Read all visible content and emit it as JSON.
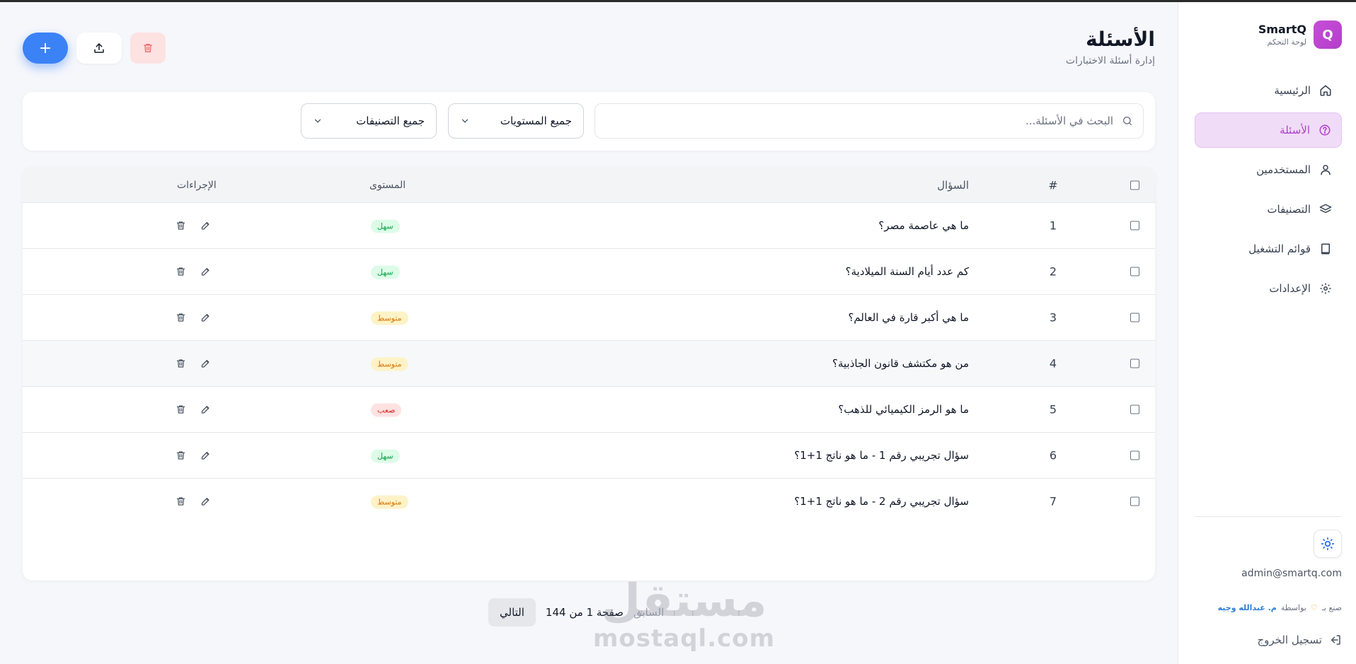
{
  "brand": {
    "logo_letter": "Q",
    "name": "SmartQ",
    "subtitle": "لوحة التحكم"
  },
  "sidebar": {
    "items": [
      {
        "label": "الرئيسية",
        "icon": "home-icon"
      },
      {
        "label": "الأسئلة",
        "icon": "help-circle-icon",
        "active": true
      },
      {
        "label": "المستخدمين",
        "icon": "user-icon"
      },
      {
        "label": "التصنيفات",
        "icon": "layers-icon"
      },
      {
        "label": "قوائم التشغيل",
        "icon": "book-icon"
      },
      {
        "label": "الإعدادات",
        "icon": "gear-icon"
      }
    ],
    "user_email": "admin@smartq.com",
    "credit_made": "صنع بـ",
    "credit_by": "بواسطة",
    "credit_author": "م. عبدالله وجيه",
    "logout_label": "تسجيل الخروج"
  },
  "header": {
    "title": "الأسئلة",
    "subtitle": "إدارة أسئلة الاختبارات",
    "add_label": "+"
  },
  "filters": {
    "search_placeholder": "البحث في الأسئلة...",
    "level_select": "جميع المستويات",
    "category_select": "جميع التصنيفات"
  },
  "table": {
    "headers": {
      "num": "#",
      "question": "السؤال",
      "level": "المستوى",
      "actions": "الإجراءات"
    },
    "rows": [
      {
        "num": "1",
        "question": "ما هي عاصمة مصر؟",
        "level": "سهل"
      },
      {
        "num": "2",
        "question": "كم عدد أيام السنة الميلادية؟",
        "level": "سهل"
      },
      {
        "num": "3",
        "question": "ما هي أكبر قارة في العالم؟",
        "level": "متوسط"
      },
      {
        "num": "4",
        "question": "من هو مكتشف قانون الجاذبية؟",
        "level": "متوسط"
      },
      {
        "num": "5",
        "question": "ما هو الرمز الكيميائي للذهب؟",
        "level": "صعب"
      },
      {
        "num": "6",
        "question": "سؤال تجريبي رقم 1 - ما هو ناتج 1+1؟",
        "level": "سهل"
      },
      {
        "num": "7",
        "question": "سؤال تجريبي رقم 2 - ما هو ناتج 1+1؟",
        "level": "متوسط"
      }
    ]
  },
  "pagination": {
    "prev_label": "السابق",
    "info": "صفحة 1 من 144",
    "next_label": "التالي"
  },
  "watermark": {
    "arabic": "مستقل",
    "latin": "mostaql.com"
  },
  "colors": {
    "primary": "#3b82f6",
    "accent": "#b03fcb",
    "danger": "#ef6b6b"
  }
}
